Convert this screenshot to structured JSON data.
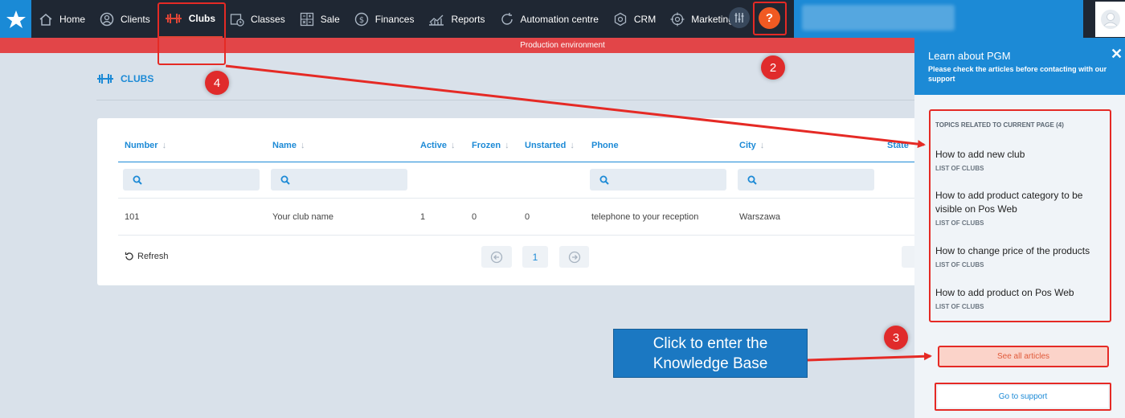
{
  "nav": {
    "items": [
      {
        "label": "Home",
        "icon": "home-icon"
      },
      {
        "label": "Clients",
        "icon": "user-circle-icon"
      },
      {
        "label": "Clubs",
        "icon": "dumbbell-icon",
        "active": true
      },
      {
        "label": "Classes",
        "icon": "calendar-clock-icon"
      },
      {
        "label": "Sale",
        "icon": "calculator-icon"
      },
      {
        "label": "Finances",
        "icon": "dollar-icon"
      },
      {
        "label": "Reports",
        "icon": "chart-icon"
      },
      {
        "label": "Automation centre",
        "icon": "refresh-icon"
      },
      {
        "label": "CRM",
        "icon": "network-icon"
      },
      {
        "label": "Marketing",
        "icon": "target-icon"
      }
    ],
    "help_label": "?"
  },
  "environment_banner": "Production environment",
  "page": {
    "title": "CLUBS",
    "columns": [
      "Number",
      "Name",
      "Active",
      "Frozen",
      "Unstarted",
      "Phone",
      "City",
      "State"
    ],
    "rows": [
      [
        "101",
        "Your club name",
        "1",
        "0",
        "0",
        "telephone to your reception",
        "Warszawa"
      ]
    ],
    "refresh_label": "Refresh",
    "current_page": "1"
  },
  "panel": {
    "title": "Learn about PGM",
    "subtitle": "Please check the articles before contacting with our support",
    "topics_heading": "TOPICS RELATED TO CURRENT PAGE (4)",
    "articles": [
      {
        "title": "How to add new club",
        "category": "LIST OF CLUBS"
      },
      {
        "title": "How to add product category to be visible on Pos Web",
        "category": "LIST OF CLUBS"
      },
      {
        "title": "How to change price of the products",
        "category": "LIST OF CLUBS"
      },
      {
        "title": "How to add product on Pos Web",
        "category": "LIST OF CLUBS"
      }
    ],
    "see_all_label": "See all articles",
    "go_support_label": "Go to support"
  },
  "annotations": {
    "badges": [
      "4",
      "2",
      "3"
    ],
    "callout": "Click to enter the Knowledge Base"
  },
  "colors": {
    "accent": "#1c8ad6",
    "nav_bg": "#1f2733",
    "banner": "#e24548",
    "annotation_red": "#e52a25"
  }
}
